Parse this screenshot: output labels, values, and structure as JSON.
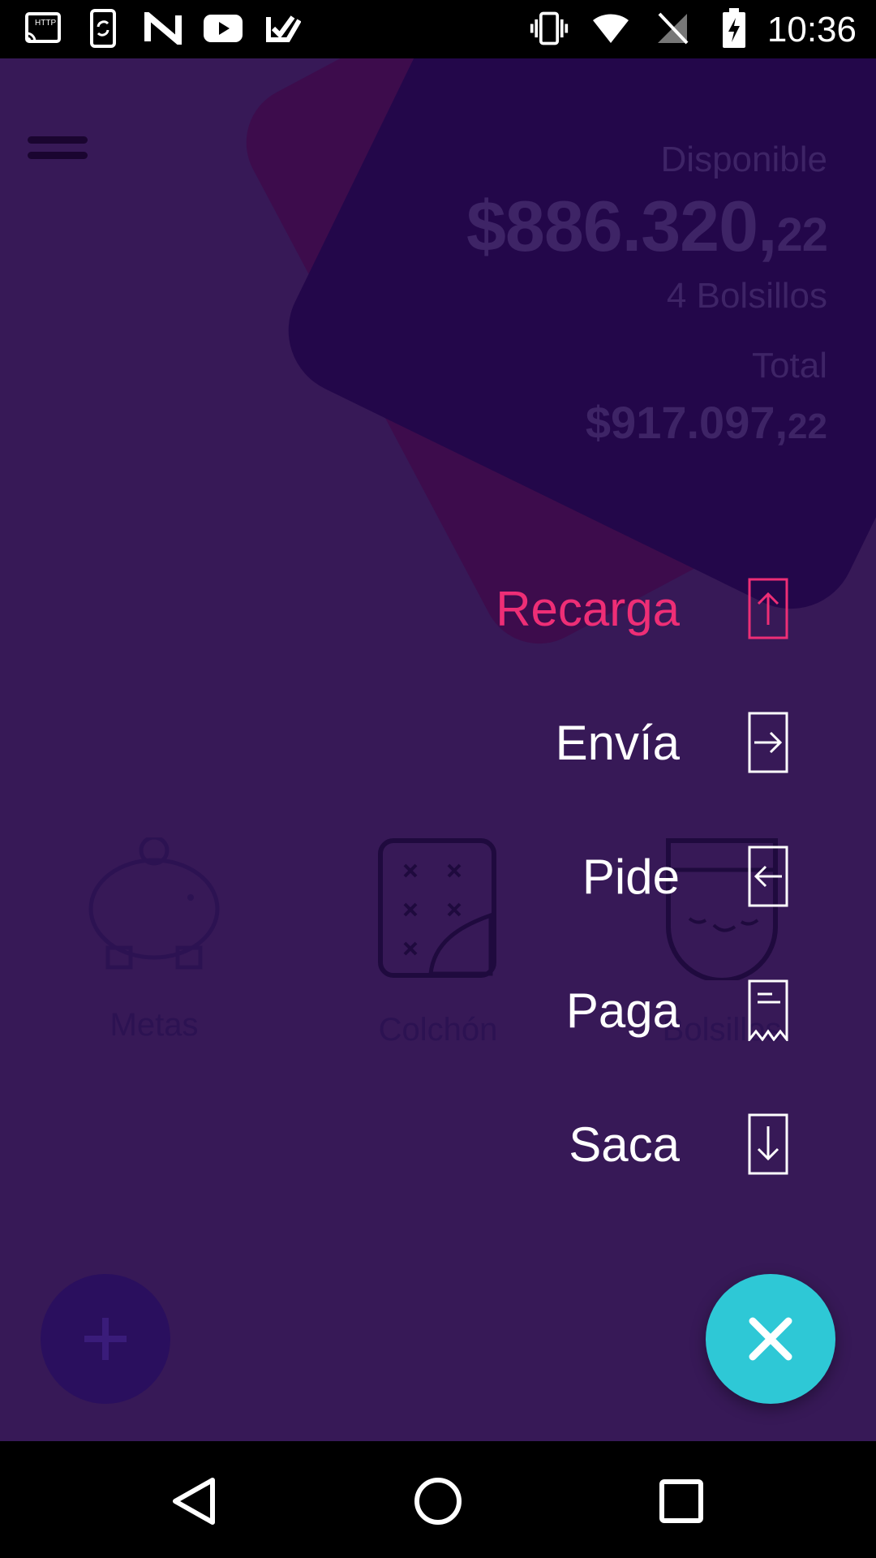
{
  "status_bar": {
    "time": "10:36",
    "left_icons": [
      "cast-http-icon",
      "phone-sync-icon",
      "n-app-icon",
      "youtube-icon",
      "check-app-icon"
    ],
    "right_icons": [
      "vibrate-icon",
      "wifi-icon",
      "no-signal-icon",
      "battery-charging-icon"
    ]
  },
  "balance": {
    "available_label": "Disponible",
    "available_amount_main": "$886.320,",
    "available_amount_cents": "22",
    "pockets_count": "4 Bolsillos",
    "total_label": "Total",
    "total_amount_main": "$917.097,",
    "total_amount_cents": "22"
  },
  "tiles": [
    {
      "label": "Metas",
      "icon": "piggy-bank-icon"
    },
    {
      "label": "Colchón",
      "icon": "mattress-icon"
    },
    {
      "label": "Bolsillos",
      "icon": "pocket-icon"
    }
  ],
  "actions": [
    {
      "label": "Recarga",
      "icon": "upload-arrow-icon",
      "active": true
    },
    {
      "label": "Envía",
      "icon": "send-arrow-icon",
      "active": false
    },
    {
      "label": "Pide",
      "icon": "request-arrow-icon",
      "active": false
    },
    {
      "label": "Paga",
      "icon": "receipt-icon",
      "active": false
    },
    {
      "label": "Saca",
      "icon": "download-arrow-icon",
      "active": false
    }
  ],
  "colors": {
    "background": "#371957",
    "accent_pink": "#ee2e76",
    "fab_teal": "#2ec8d6"
  }
}
